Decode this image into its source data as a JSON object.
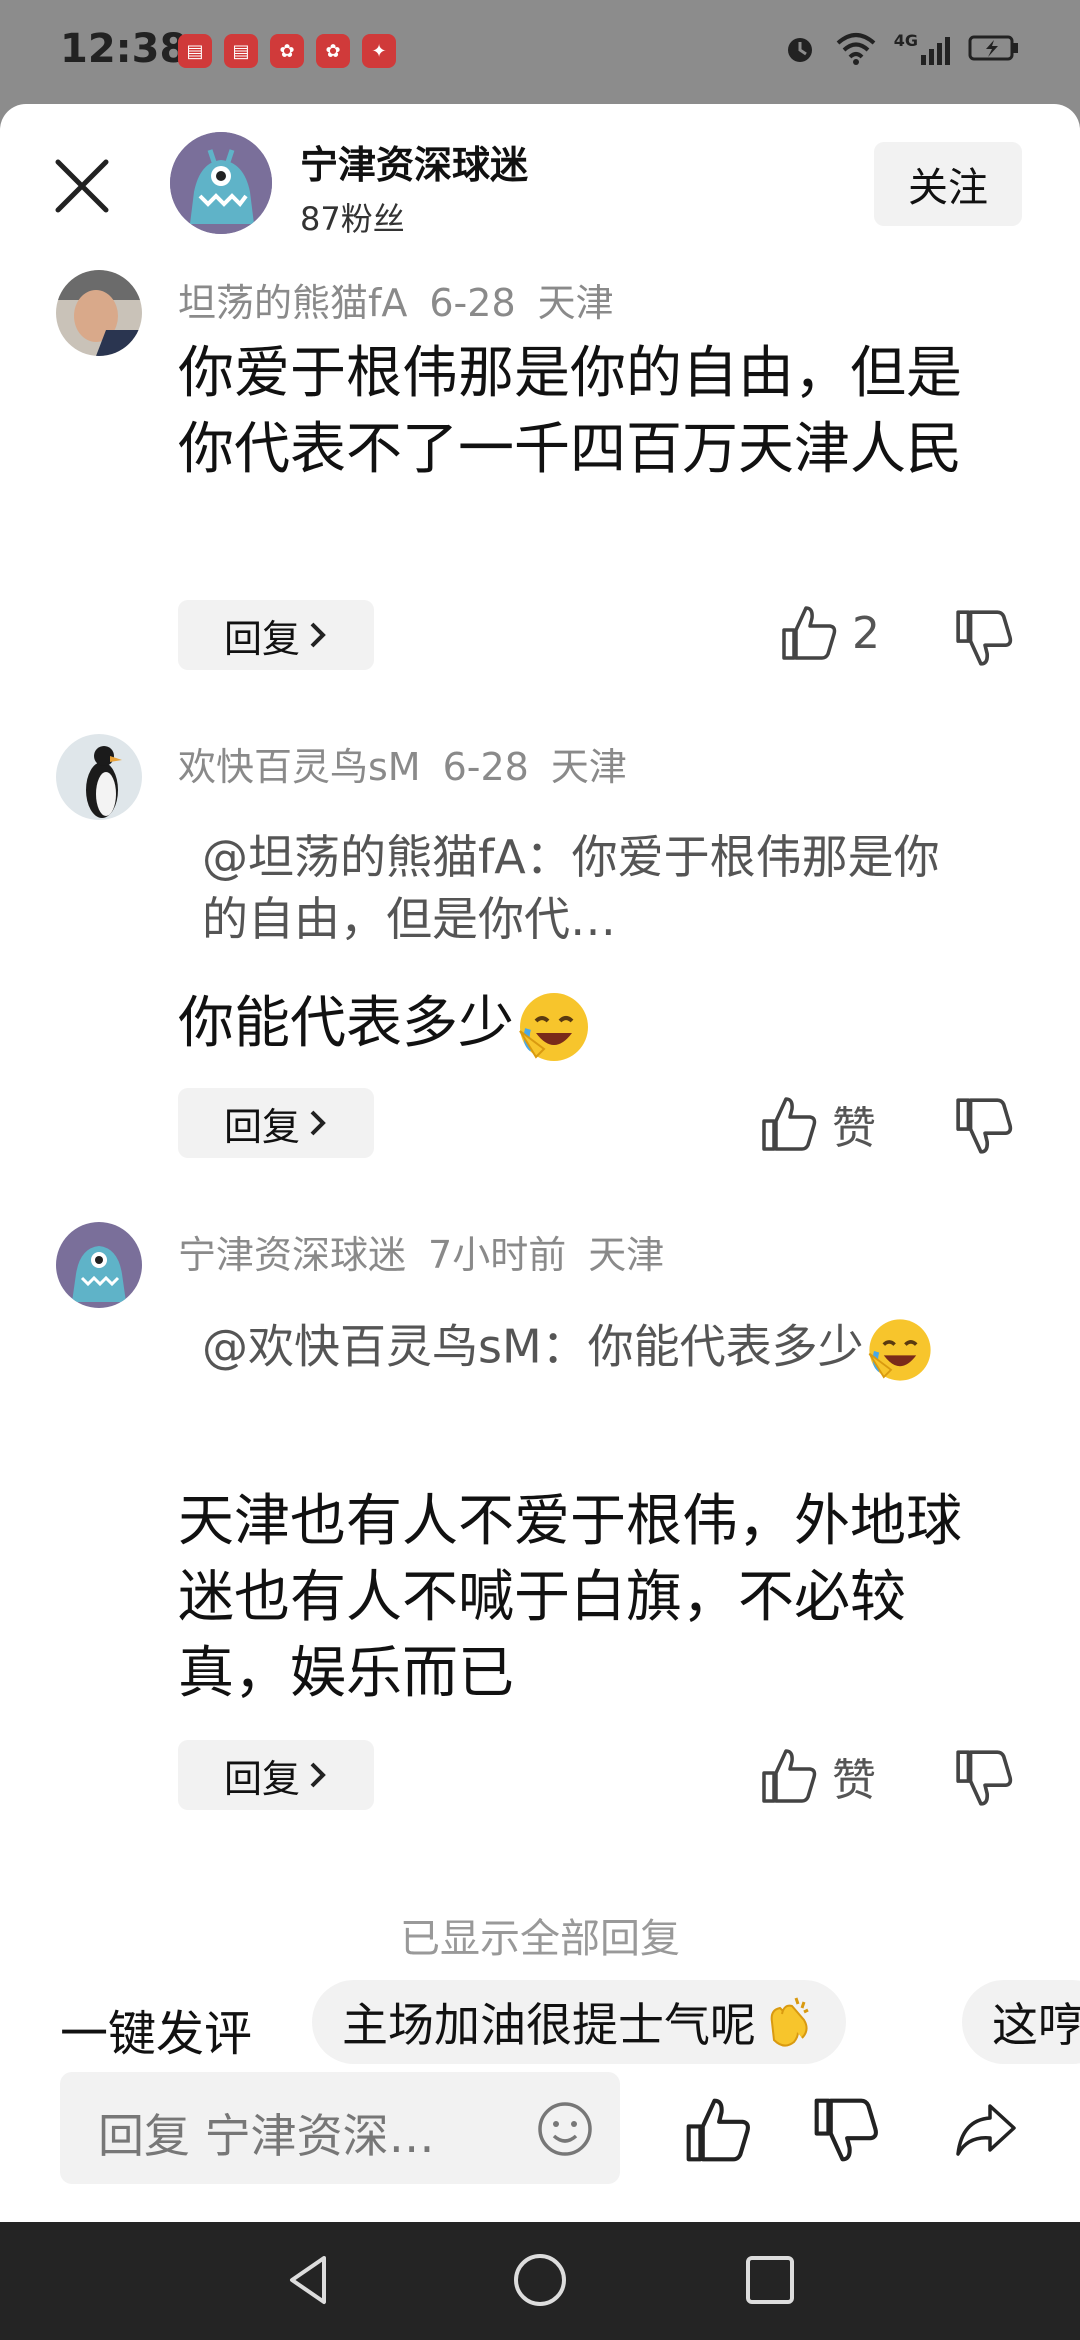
{
  "status_bar": {
    "time": "12:38",
    "network": "4G"
  },
  "header": {
    "author_name": "宁津资深球迷",
    "fans": "87粉丝",
    "follow_label": "关注"
  },
  "comments": [
    {
      "user": "坦荡的熊猫fA",
      "date": "6-28",
      "location": "天津",
      "text": "你爱于根伟那是你的自由，但是你代表不了一千四百万天津人民",
      "reply_label": "回复",
      "likes": "2"
    },
    {
      "user": "欢快百灵鸟sM",
      "date": "6-28",
      "location": "天津",
      "quote": "@坦荡的熊猫fA：你爱于根伟那是你的自由，但是你代…",
      "text": "你能代表多少",
      "reply_label": "回复",
      "likes": "赞"
    },
    {
      "user": "宁津资深球迷",
      "date": "7小时前",
      "location": "天津",
      "quote": "@欢快百灵鸟sM：你能代表多少",
      "text": "天津也有人不爱于根伟，外地球迷也有人不喊于白旗，不必较真，娱乐而已",
      "reply_label": "回复",
      "likes": "赞"
    }
  ],
  "footer_note": "已显示全部回复",
  "quick_comments": {
    "label": "一键发评",
    "chips": [
      "主场加油很提士气呢",
      "这哼"
    ]
  },
  "reply_input": {
    "placeholder": "回复 宁津资深…"
  },
  "icons": [
    "close-icon",
    "thumbs-up-icon",
    "thumbs-down-icon",
    "chevron-right-icon",
    "smiley-icon",
    "share-icon",
    "back-icon",
    "home-icon",
    "recents-icon"
  ]
}
